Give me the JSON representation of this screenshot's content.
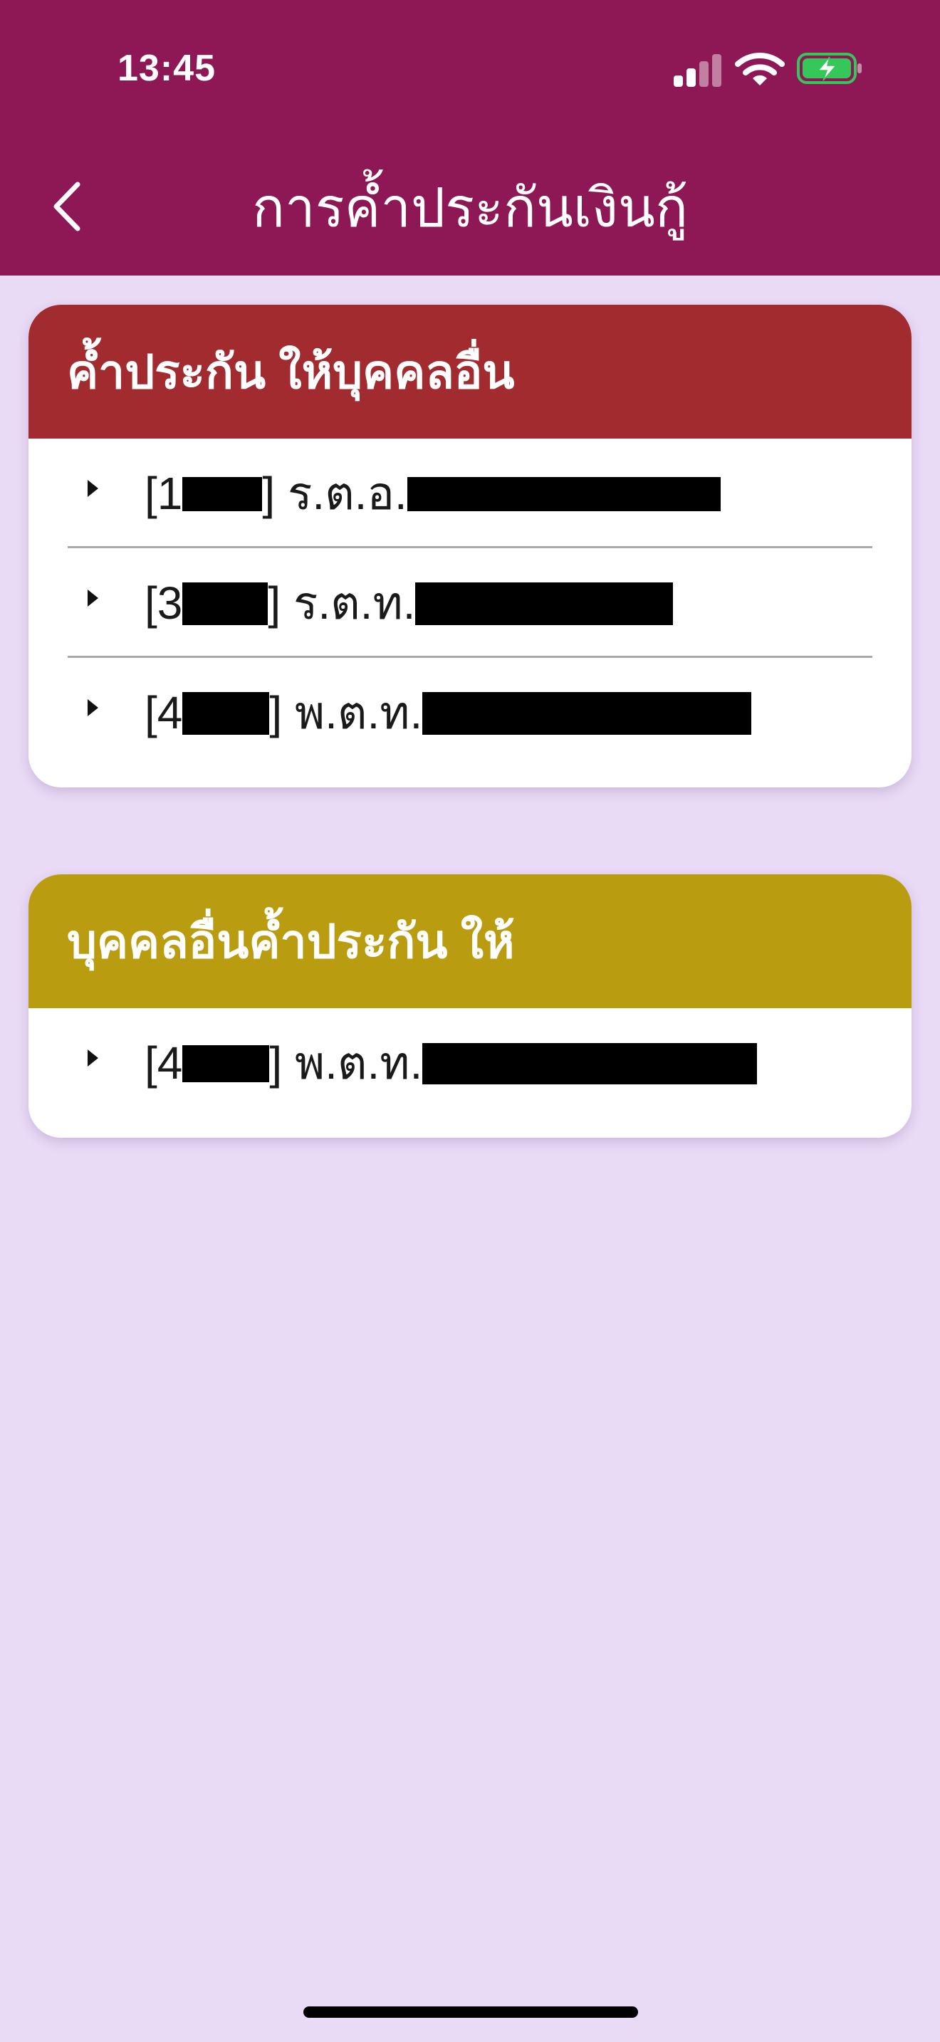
{
  "status_bar": {
    "time": "13:45",
    "icons": [
      "signal-icon",
      "wifi-icon",
      "battery-charging-icon"
    ],
    "battery_color": "#35c759"
  },
  "nav": {
    "title": "การค้ำประกันเงินกู้",
    "back_icon": "chevron-left-icon"
  },
  "colors": {
    "header_bg": "#8e1756",
    "page_bg": "#e9daf6",
    "section1_header": "#a12b2f",
    "section2_header": "#b99c10"
  },
  "sections": [
    {
      "title": "ค้ำประกัน ให้บุคคลอื่น",
      "items": [
        {
          "prefix": "[1",
          "mid": "] ร.ต.อ."
        },
        {
          "prefix": "[3",
          "mid": "] ร.ต.ท."
        },
        {
          "prefix": "[4",
          "mid": "] พ.ต.ท."
        }
      ]
    },
    {
      "title": "บุคคลอื่นค้ำประกัน ให้",
      "items": [
        {
          "prefix": "[4",
          "mid": "] พ.ต.ท."
        }
      ]
    }
  ]
}
